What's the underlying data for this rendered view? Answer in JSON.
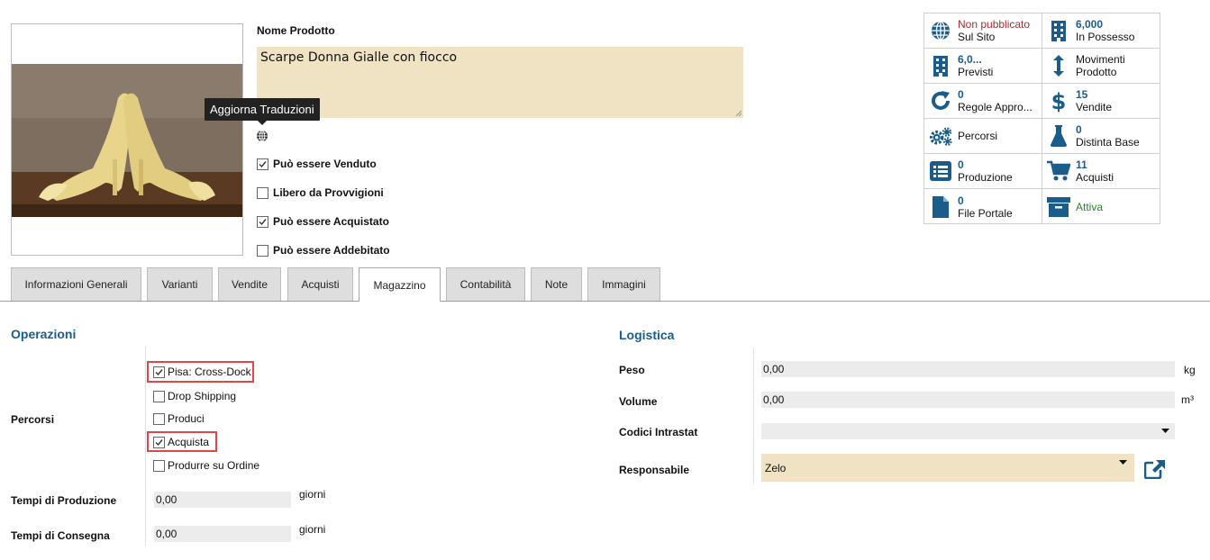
{
  "product": {
    "name_label": "Nome Prodotto",
    "name_value": "Scarpe Donna Gialle con fiocco",
    "tooltip": "Aggiorna Traduzioni",
    "checkboxes": [
      {
        "label": "Può essere Venduto",
        "checked": true
      },
      {
        "label": "Libero da Provvigioni",
        "checked": false
      },
      {
        "label": "Può essere Acquistato",
        "checked": true
      },
      {
        "label": "Può essere Addebitato",
        "checked": false
      }
    ]
  },
  "stats": [
    {
      "icon": "globe-icon",
      "value": "Non pubblicato",
      "label": "Sul Sito"
    },
    {
      "icon": "building-icon",
      "value": "6,000",
      "label": "In Possesso"
    },
    {
      "icon": "building-icon",
      "value": "6,0...",
      "label": "Previsti"
    },
    {
      "icon": "arrows-vertical-icon",
      "value": "Movimenti",
      "label": "Prodotto"
    },
    {
      "icon": "refresh-icon",
      "value": "0",
      "label": "Regole Appro..."
    },
    {
      "icon": "dollar-icon",
      "value": "15",
      "label": "Vendite"
    },
    {
      "icon": "cogs-icon",
      "value": "",
      "label": "Percorsi"
    },
    {
      "icon": "flask-icon",
      "value": "0",
      "label": "Distinta Base"
    },
    {
      "icon": "list-icon",
      "value": "0",
      "label": "Produzione"
    },
    {
      "icon": "cart-icon",
      "value": "11",
      "label": "Acquisti"
    },
    {
      "icon": "file-icon",
      "value": "0",
      "label": "File Portale"
    },
    {
      "icon": "archive-icon",
      "value": "",
      "label": "Attiva"
    }
  ],
  "tabs": [
    {
      "label": "Informazioni Generali"
    },
    {
      "label": "Varianti"
    },
    {
      "label": "Vendite"
    },
    {
      "label": "Acquisti"
    },
    {
      "label": "Magazzino",
      "active": true
    },
    {
      "label": "Contabilità"
    },
    {
      "label": "Note"
    },
    {
      "label": "Immagini"
    }
  ],
  "operations": {
    "title": "Operazioni",
    "routes_label": "Percorsi",
    "routes": [
      {
        "label": "Pisa: Cross-Dock",
        "checked": true
      },
      {
        "label": "Drop Shipping",
        "checked": false
      },
      {
        "label": "Produci",
        "checked": false
      },
      {
        "label": "Acquista",
        "checked": true
      },
      {
        "label": "Produrre su Ordine",
        "checked": false
      }
    ],
    "production_time_label": "Tempi di Produzione",
    "production_time_value": "0,00",
    "production_time_unit": "giorni",
    "delivery_time_label": "Tempi di Consegna",
    "delivery_time_value": "0,00",
    "delivery_time_unit": "giorni"
  },
  "logistics": {
    "title": "Logistica",
    "weight_label": "Peso",
    "weight_value": "0,00",
    "weight_unit": "kg",
    "volume_label": "Volume",
    "volume_value": "0,00",
    "volume_unit": "m³",
    "intrastat_label": "Codici Intrastat",
    "intrastat_value": "",
    "responsible_label": "Responsabile",
    "responsible_value": "Zelo"
  },
  "colors": {
    "accent": "#1a5c8a",
    "required_field": "#f0e3c4",
    "highlight": "#e04646",
    "unpublished": "#a33030",
    "active": "#2e7d32"
  }
}
